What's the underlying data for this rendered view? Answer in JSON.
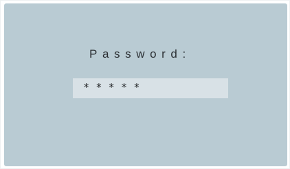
{
  "login": {
    "password_label": "Password:",
    "password_value_masked": "*****"
  },
  "colors": {
    "screen_background": "#b9cbd3",
    "field_background": "#d8e1e6",
    "text": "#2b2f33"
  }
}
